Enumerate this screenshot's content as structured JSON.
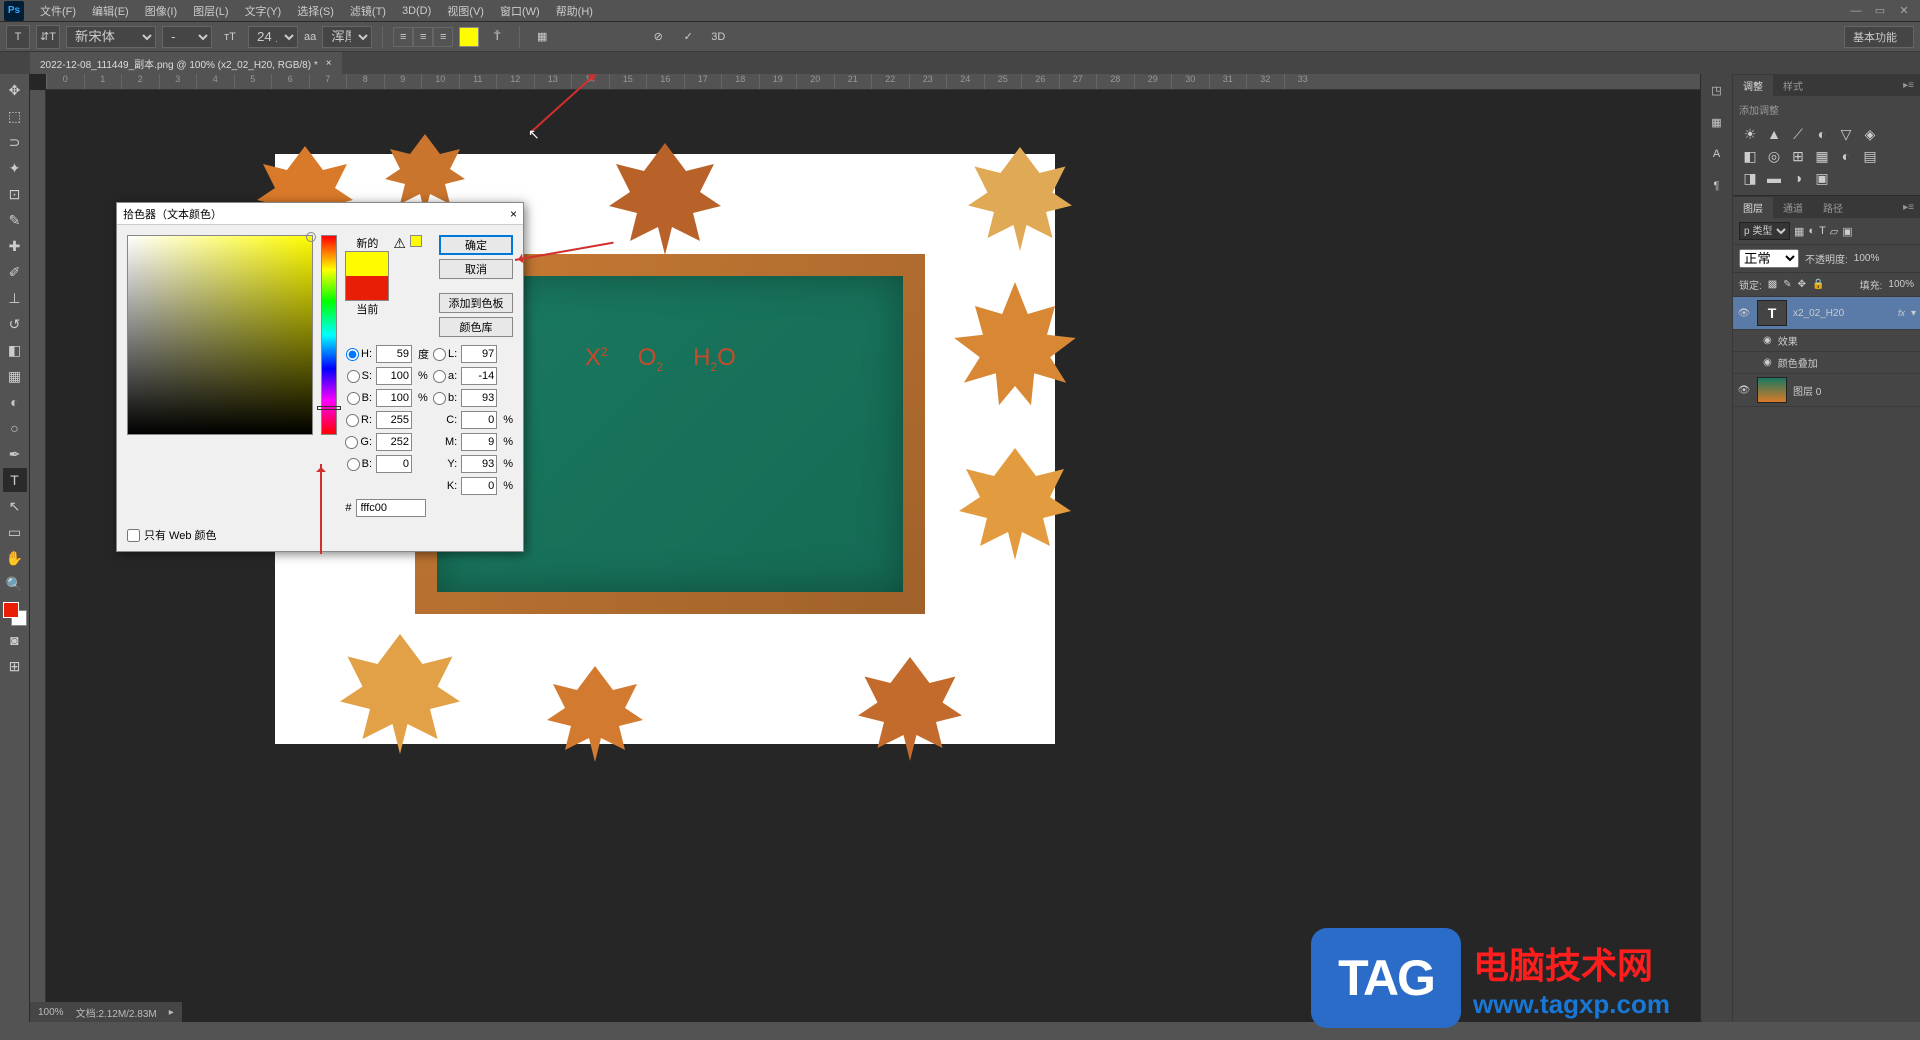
{
  "menu": [
    "文件(F)",
    "编辑(E)",
    "图像(I)",
    "图层(L)",
    "文字(Y)",
    "选择(S)",
    "滤镜(T)",
    "3D(D)",
    "视图(V)",
    "窗口(W)",
    "帮助(H)"
  ],
  "options": {
    "font": "新宋体",
    "style": "-",
    "size": "24 点",
    "aa": "浑厚",
    "aa_label": "aa",
    "right_label": "基本功能",
    "threeD": "3D"
  },
  "tab": {
    "title": "2022-12-08_111449_副本.png @ 100% (x2_02_H20, RGB/8) *"
  },
  "color_picker": {
    "title": "拾色器（文本颜色）",
    "new_label": "新的",
    "current_label": "当前",
    "ok": "确定",
    "cancel": "取消",
    "add_swatch": "添加到色板",
    "color_lib": "颜色库",
    "web_only": "只有 Web 颜色",
    "H": "59",
    "H_unit": "度",
    "S": "100",
    "S_unit": "%",
    "Bv": "100",
    "Bv_unit": "%",
    "R": "255",
    "G": "252",
    "B": "0",
    "L": "97",
    "a": "-14",
    "b": "93",
    "C": "0",
    "C_unit": "%",
    "M": "9",
    "M_unit": "%",
    "Y": "93",
    "Y_unit": "%",
    "K": "0",
    "K_unit": "%",
    "hex": "fffc00"
  },
  "canvas_text": {
    "t1": "X",
    "t1_sup": "2",
    "t2": "O",
    "t2_sub": "2",
    "t3a": "H",
    "t3_sub": "2",
    "t3b": "O"
  },
  "adjustments": {
    "tab1": "调整",
    "tab2": "样式",
    "label": "添加调整"
  },
  "layers": {
    "tab1": "图层",
    "tab2": "通道",
    "tab3": "路径",
    "kind": "р 类型",
    "mode": "正常",
    "opacity_label": "不透明度:",
    "opacity": "100%",
    "lock_label": "锁定:",
    "fill_label": "填充:",
    "fill": "100%",
    "items": [
      {
        "name": "x2_02_H20",
        "fx": "fx"
      },
      {
        "name": "效果"
      },
      {
        "name": "颜色叠加"
      },
      {
        "name": "图层 0"
      }
    ]
  },
  "status": {
    "zoom": "100%",
    "doc": "文档:2.12M/2.83M"
  },
  "watermark": {
    "badge": "TAG",
    "line1": "电脑技术网",
    "line2": "www.tagxp.com"
  },
  "ruler_marks": [
    "0",
    "1",
    "2",
    "3",
    "4",
    "5",
    "6",
    "7",
    "8",
    "9",
    "10",
    "11",
    "12",
    "13",
    "14",
    "15",
    "16",
    "17",
    "18",
    "19",
    "20",
    "21",
    "22",
    "23",
    "24",
    "25",
    "26",
    "27",
    "28",
    "29",
    "30",
    "31",
    "32",
    "33"
  ]
}
